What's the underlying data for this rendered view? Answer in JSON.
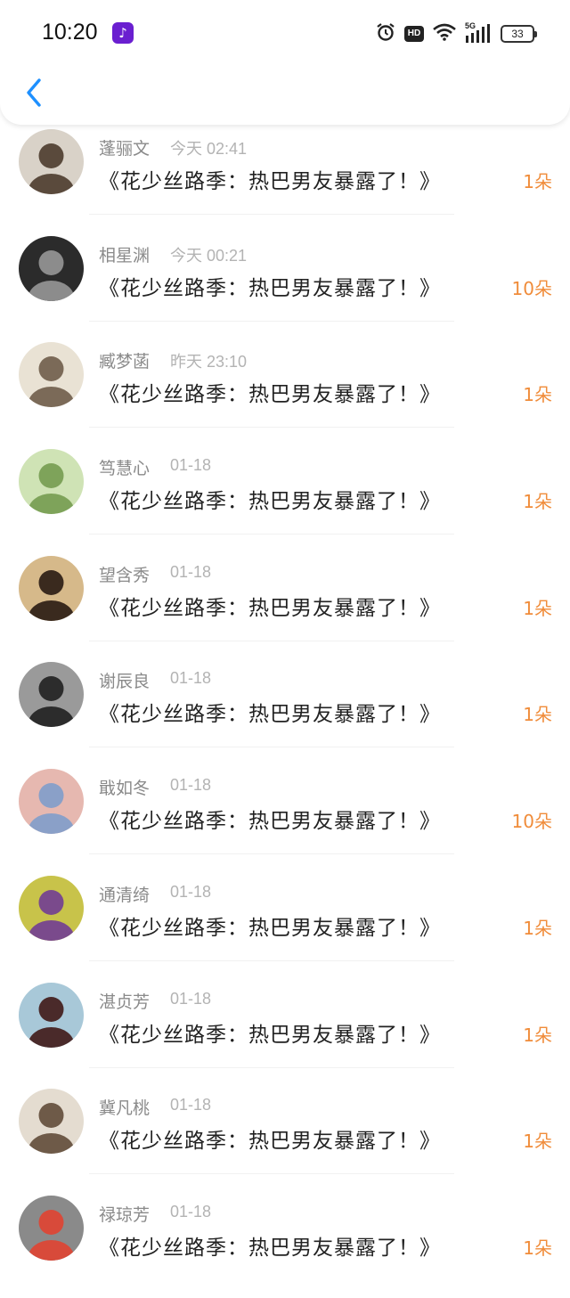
{
  "status_bar": {
    "time": "10:20",
    "app_icon": "tiktok-icon",
    "hd": "HD",
    "network": "5G",
    "battery": "33"
  },
  "header": {
    "back_icon": "chevron-left-icon"
  },
  "colors": {
    "accent": "#1e90ff",
    "count": "#f08c3a",
    "name": "#8a8a8a",
    "time": "#b3b3b3",
    "title": "#222222"
  },
  "items": [
    {
      "name": "蓬骊文",
      "time": "今天 02:41",
      "title": "《花少丝路季：热巴男友暴露了！》",
      "count": "1朵",
      "avatar_colors": [
        "#d9d2c8",
        "#5a4a3c"
      ]
    },
    {
      "name": "相星渊",
      "time": "今天 00:21",
      "title": "《花少丝路季：热巴男友暴露了！》",
      "count": "10朵",
      "avatar_colors": [
        "#2b2b2b",
        "#8c8c8c"
      ]
    },
    {
      "name": "臧梦菡",
      "time": "昨天 23:10",
      "title": "《花少丝路季：热巴男友暴露了！》",
      "count": "1朵",
      "avatar_colors": [
        "#e9e2d4",
        "#7b6a58"
      ]
    },
    {
      "name": "笃慧心",
      "time": "01-18",
      "title": "《花少丝路季：热巴男友暴露了！》",
      "count": "1朵",
      "avatar_colors": [
        "#cfe3b5",
        "#7ea35a"
      ]
    },
    {
      "name": "望含秀",
      "time": "01-18",
      "title": "《花少丝路季：热巴男友暴露了！》",
      "count": "1朵",
      "avatar_colors": [
        "#d6b98a",
        "#3a2a1e"
      ]
    },
    {
      "name": "谢辰良",
      "time": "01-18",
      "title": "《花少丝路季：热巴男友暴露了！》",
      "count": "1朵",
      "avatar_colors": [
        "#9a9a9a",
        "#2c2c2c"
      ]
    },
    {
      "name": "戢如冬",
      "time": "01-18",
      "title": "《花少丝路季：热巴男友暴露了！》",
      "count": "10朵",
      "avatar_colors": [
        "#e6b8b0",
        "#8aa0c8"
      ]
    },
    {
      "name": "通清绮",
      "time": "01-18",
      "title": "《花少丝路季：热巴男友暴露了！》",
      "count": "1朵",
      "avatar_colors": [
        "#c8c34a",
        "#7a4a8c"
      ]
    },
    {
      "name": "湛贞芳",
      "time": "01-18",
      "title": "《花少丝路季：热巴男友暴露了！》",
      "count": "1朵",
      "avatar_colors": [
        "#a8c8d8",
        "#4a2a2a"
      ]
    },
    {
      "name": "冀凡桃",
      "time": "01-18",
      "title": "《花少丝路季：热巴男友暴露了！》",
      "count": "1朵",
      "avatar_colors": [
        "#e4dcd0",
        "#6e5a48"
      ]
    },
    {
      "name": "禄琼芳",
      "time": "01-18",
      "title": "《花少丝路季：热巴男友暴露了！》",
      "count": "1朵",
      "avatar_colors": [
        "#8a8a8a",
        "#d84a3a"
      ]
    }
  ]
}
